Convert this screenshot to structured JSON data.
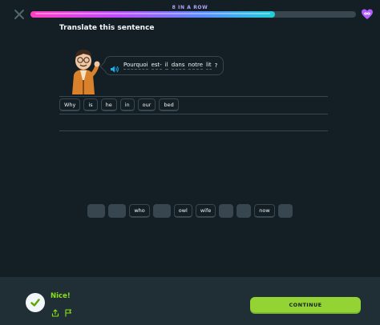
{
  "header": {
    "streak_text": "8 IN A ROW",
    "progress_fraction": 0.75,
    "close_icon": "close-icon",
    "hearts_icon": "infinity-heart-icon"
  },
  "prompt": {
    "title": "Translate this sentence"
  },
  "sentence": {
    "speaker_icon": "speaker-icon",
    "words": [
      "Pourquoi",
      "est-",
      "il",
      "dans",
      "notre",
      "lit",
      "?"
    ]
  },
  "answer": {
    "words": [
      "Why",
      "is",
      "he",
      "in",
      "our",
      "bed"
    ]
  },
  "word_bank": [
    {
      "label": "",
      "used": true
    },
    {
      "label": "",
      "used": true
    },
    {
      "label": "who",
      "used": false
    },
    {
      "label": "",
      "used": true
    },
    {
      "label": "owl",
      "used": false
    },
    {
      "label": "wife",
      "used": false
    },
    {
      "label": "",
      "used": true
    },
    {
      "label": "",
      "used": true
    },
    {
      "label": "now",
      "used": false
    },
    {
      "label": "",
      "used": true
    }
  ],
  "feedback": {
    "status": "Nice!",
    "check_icon": "check-icon",
    "share_icon": "share-icon",
    "flag_icon": "flag-icon",
    "continue_label": "CONTINUE"
  },
  "colors": {
    "background": "#131f24",
    "footer": "#202f36",
    "accent_green": "#93d333",
    "success_text": "#89e219",
    "border": "#37464f"
  }
}
